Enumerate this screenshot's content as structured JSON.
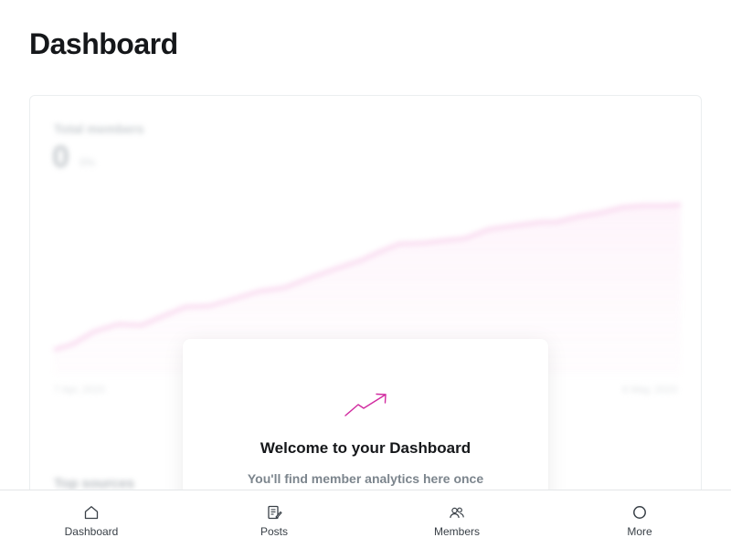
{
  "page": {
    "title": "Dashboard"
  },
  "background_card": {
    "metric_label": "Total members",
    "metric_value": "0",
    "metric_delta": "0%",
    "date_start": "7 Apr, 2023",
    "date_end": "6 May, 2023",
    "sources_label": "Top sources"
  },
  "welcome": {
    "title": "Welcome to your Dashboard",
    "body": "You'll find member analytics here once"
  },
  "bottom_nav": {
    "items": [
      {
        "label": "Dashboard",
        "icon": "home-icon"
      },
      {
        "label": "Posts",
        "icon": "posts-icon"
      },
      {
        "label": "Members",
        "icon": "members-icon"
      },
      {
        "label": "More",
        "icon": "circle-icon"
      }
    ]
  },
  "colors": {
    "chart_accent": "#f3b7e1",
    "trend_icon": "#d12ba0"
  }
}
